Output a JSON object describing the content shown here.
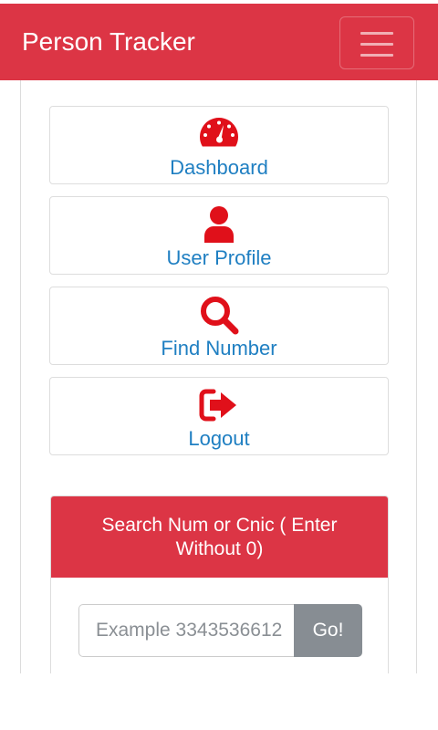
{
  "header": {
    "brand": "Person Tracker",
    "menu_icon": "hamburger-menu-icon"
  },
  "menu": {
    "items": [
      {
        "label": "Dashboard",
        "icon": "speedometer-icon"
      },
      {
        "label": "User Profile",
        "icon": "user-icon"
      },
      {
        "label": "Find Number",
        "icon": "search-icon"
      },
      {
        "label": "Logout",
        "icon": "logout-icon"
      }
    ]
  },
  "search": {
    "title": "Search Num or Cnic ( Enter Without 0)",
    "placeholder": "Example 3343536612",
    "value": "",
    "go_label": "Go!"
  },
  "colors": {
    "brand": "#dc3545",
    "icon": "#e0101a",
    "link": "#1f7fc2",
    "button": "#878d93"
  }
}
